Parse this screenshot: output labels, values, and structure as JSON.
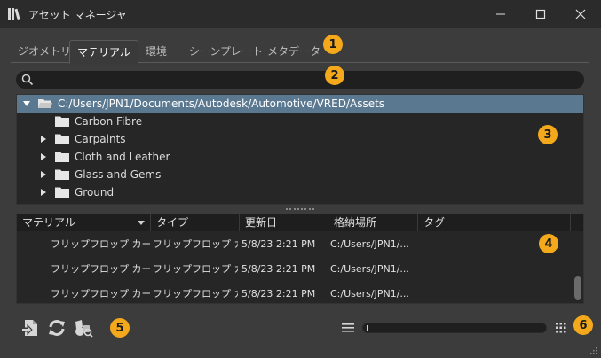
{
  "window": {
    "title": "アセット マネージャ",
    "controls": {
      "minimize": "minimize-icon",
      "maximize": "maximize-icon",
      "close": "close-icon"
    }
  },
  "tabs": [
    {
      "label": "ジオメトリ",
      "active": false
    },
    {
      "label": "マテリアル",
      "active": true
    },
    {
      "label": "環境",
      "active": false
    },
    {
      "label": "シーンプレート",
      "active": false
    },
    {
      "label": "メタデータ",
      "active": false
    }
  ],
  "search": {
    "value": "",
    "placeholder": ""
  },
  "tree": {
    "root": {
      "label": "C:/Users/JPN1/Documents/Autodesk/Automotive/VRED/Assets",
      "expanded": true,
      "selected": true
    },
    "children": [
      {
        "label": "Carbon Fibre",
        "expandable": false
      },
      {
        "label": "Carpaints",
        "expandable": true
      },
      {
        "label": "Cloth and Leather",
        "expandable": true
      },
      {
        "label": "Glass and Gems",
        "expandable": true
      },
      {
        "label": "Ground",
        "expandable": true
      }
    ]
  },
  "table": {
    "columns": [
      "マテリアル",
      "タイプ",
      "更新日",
      "格納場所",
      "タグ"
    ],
    "rows": [
      {
        "name": "フリップフロップ カーペ...",
        "type": "フリップフロップ カ...",
        "date": "5/8/23 2:21 PM",
        "location": "C:/Users/JPN1/...",
        "tag": ""
      },
      {
        "name": "フリップフロップ カーペ...",
        "type": "フリップフロップ カ...",
        "date": "5/8/23 2:21 PM",
        "location": "C:/Users/JPN1/...",
        "tag": ""
      },
      {
        "name": "フリップフロップ カーペ...",
        "type": "フリップフロップ カ...",
        "date": "5/8/23 2:21 PM",
        "location": "C:/Users/JPN1/...",
        "tag": ""
      }
    ]
  },
  "toolbar": {
    "left_icons": [
      "import-file-icon",
      "refresh-icon",
      "find-assets-icon"
    ],
    "right_icons": [
      "list-view-icon",
      "thumbnail-size-slider",
      "grid-view-icon"
    ],
    "thumbnail_size": 0.02
  },
  "callouts": [
    "1",
    "2",
    "3",
    "4",
    "5",
    "6"
  ],
  "colors": {
    "accent_callout": "#f3a91b",
    "selection": "#5a7890",
    "background": "#3c3c3c",
    "panel": "#262626"
  }
}
